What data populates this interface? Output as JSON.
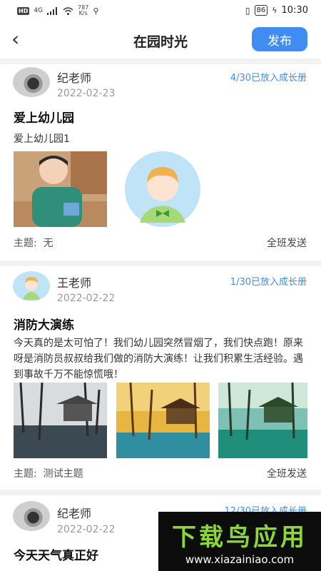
{
  "status": {
    "carrier": "HD",
    "network": "4G",
    "speed_value": "787",
    "speed_unit": "K/s",
    "battery": "86",
    "time": "10:30"
  },
  "header": {
    "back_icon": "chevron-left-icon",
    "title": "在园时光",
    "publish_label": "发布"
  },
  "posts": [
    {
      "teacher": "纪老师",
      "date": "2022-02-23",
      "growth": "4/30已放入成长册",
      "title": "爱上幼儿园",
      "desc": "爱上幼儿园1",
      "topic_label": "主题:",
      "topic_value": "无",
      "send": "全班发送"
    },
    {
      "teacher": "王老师",
      "date": "2022-02-22",
      "growth": "1/30已放入成长册",
      "title": "消防大演练",
      "desc": "今天真的是太可怕了！我们幼儿园突然冒烟了，我们快点跑！原来呀是消防员叔叔给我们做的消防大演练！让我们积累生活经验。遇到事故千万不能惊慌哦！",
      "topic_label": "主题:",
      "topic_value": "测试主题",
      "send": "全班发送"
    },
    {
      "teacher": "纪老师",
      "date": "2022-02-22",
      "growth": "12/30已放入成长册",
      "title": "今天天气真正好"
    }
  ],
  "watermark": {
    "text1": "下载鸟应用",
    "text2": "www.xiazainiao.com"
  }
}
